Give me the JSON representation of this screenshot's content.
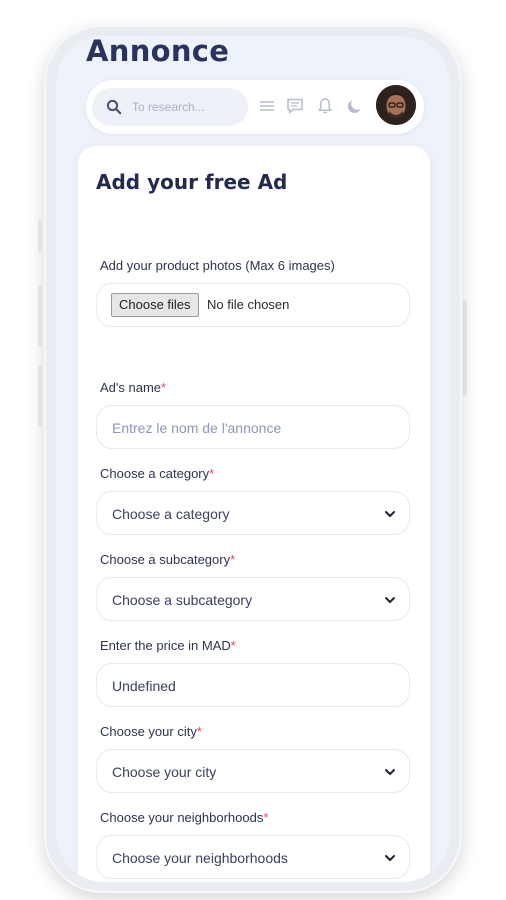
{
  "app_title": "Annonce",
  "search": {
    "placeholder": "To research..."
  },
  "header_icons": [
    "menu-icon",
    "chat-icon",
    "bell-icon",
    "moon-icon"
  ],
  "form": {
    "title": "Add your free Ad",
    "photos": {
      "label": "Add your product photos (Max 6 images)",
      "button": "Choose files",
      "status": "No file chosen"
    },
    "required_mark": "*",
    "ad_name": {
      "label": "Ad's name",
      "placeholder": "Entrez le nom de l'annonce"
    },
    "category": {
      "label": "Choose a category",
      "value": "Choose a category"
    },
    "subcategory": {
      "label": "Choose a subcategory",
      "value": "Choose a subcategory"
    },
    "price": {
      "label": "Enter the price in MAD",
      "value": "Undefined"
    },
    "city": {
      "label": "Choose your city",
      "value": "Choose your city"
    },
    "neighborhood": {
      "label": "Choose your neighborhoods",
      "value": "Choose your neighborhoods"
    }
  },
  "colors": {
    "title": "#2a3260",
    "required": "#e3465d",
    "screen_bg": "#eef2fa"
  }
}
